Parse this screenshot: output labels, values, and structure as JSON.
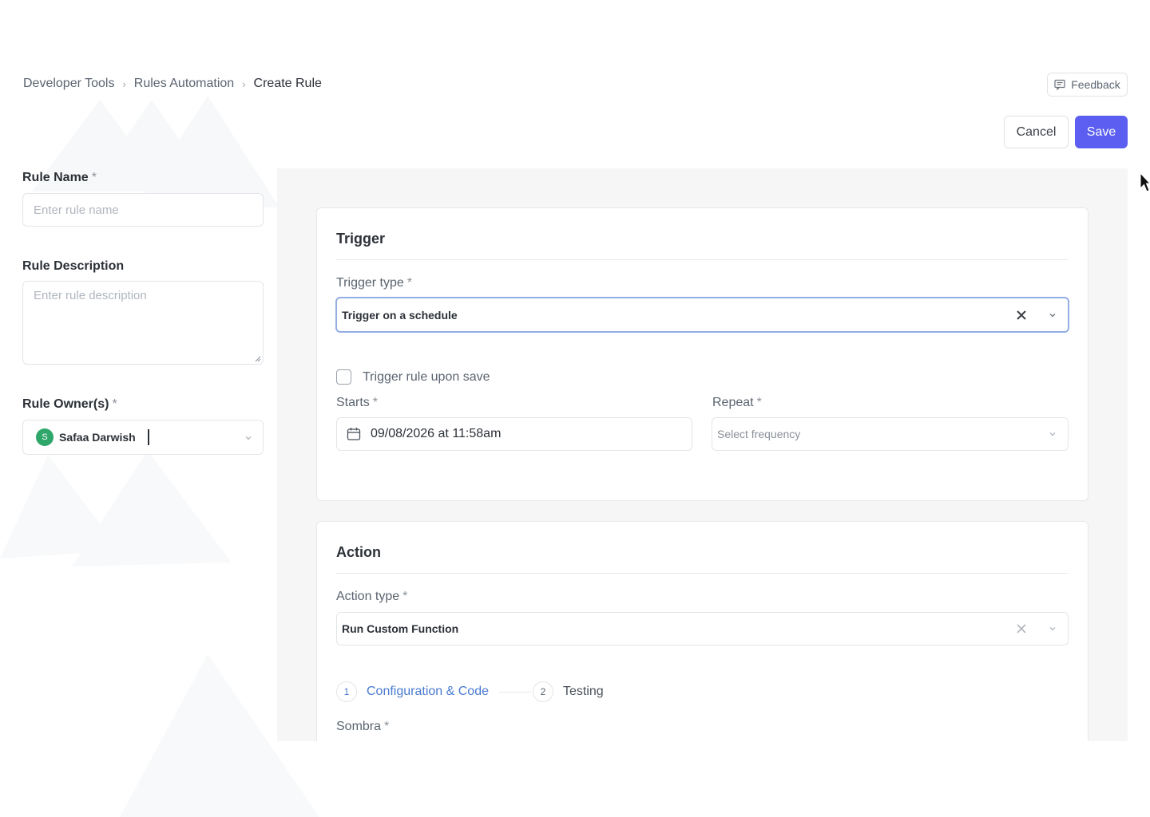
{
  "breadcrumb": {
    "items": [
      "Developer Tools",
      "Rules Automation",
      "Create Rule"
    ],
    "separator": "›"
  },
  "header": {
    "feedback_label": "Feedback",
    "cancel_label": "Cancel",
    "save_label": "Save"
  },
  "rule_form": {
    "name_label": "Rule Name",
    "name_required": "*",
    "name_placeholder": "Enter rule name",
    "description_label": "Rule Description",
    "description_placeholder": "Enter rule description",
    "owners_label": "Rule Owner(s)",
    "owners_required": "*",
    "owner": {
      "initial": "S",
      "name": "Safaa Darwish"
    }
  },
  "trigger": {
    "title": "Trigger",
    "type_label": "Trigger type",
    "type_required": "*",
    "type_value": "Trigger on a schedule",
    "upon_save_label": "Trigger rule upon save",
    "upon_save_checked": false,
    "starts_label": "Starts",
    "starts_required": "*",
    "starts_value": "09/08/2026 at 11:58am",
    "repeat_label": "Repeat",
    "repeat_required": "*",
    "repeat_placeholder": "Select frequency"
  },
  "action": {
    "title": "Action",
    "type_label": "Action type",
    "type_required": "*",
    "type_value": "Run Custom Function",
    "steps": [
      {
        "number": "1",
        "label": "Configuration & Code",
        "active": true
      },
      {
        "number": "2",
        "label": "Testing",
        "active": false
      }
    ],
    "sombra_label": "Sombra",
    "sombra_required": "*"
  },
  "colors": {
    "primary": "#5b5ef0",
    "active_step": "#4a7bd0",
    "avatar": "#2fa66a",
    "focus_border": "#93aee3"
  },
  "icons": [
    "feedback-icon",
    "calendar-icon",
    "close-icon",
    "chevron-down-icon",
    "cursor-icon"
  ]
}
